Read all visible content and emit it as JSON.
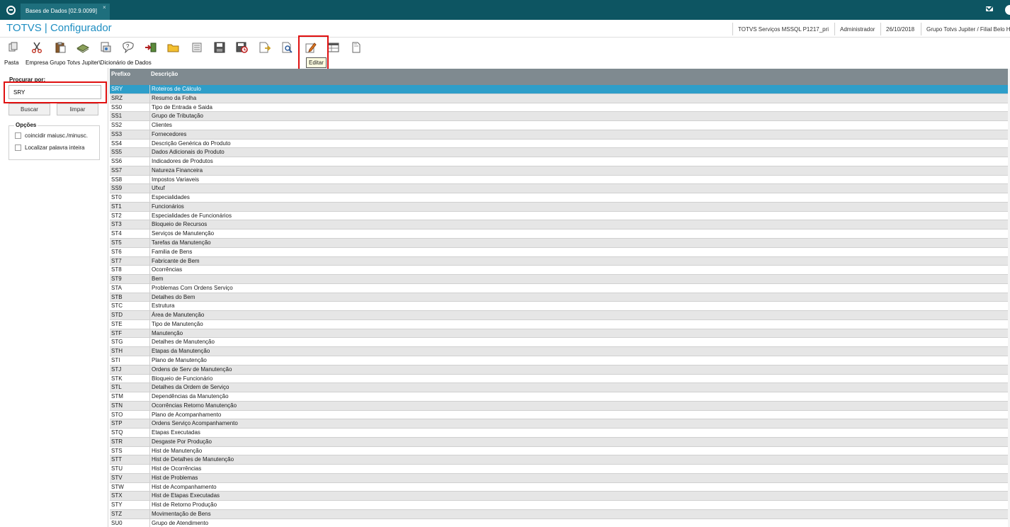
{
  "window": {
    "tab_label": "Bases de Dados [02.9.0099]",
    "tab_close": "×"
  },
  "header": {
    "app_title": "TOTVS | Configurador",
    "service": "TOTVS Serviços MSSQL P1217_pri",
    "user": "Administrador",
    "date": "26/10/2018",
    "company": "Grupo Totvs Jupiter / Filial Belo H"
  },
  "toolbar": {
    "tooltip": "Editar"
  },
  "breadcrumb": {
    "root": "Pasta",
    "path": "Empresa Grupo Totvs Jupiter\\Dicionário de Dados"
  },
  "search": {
    "label": "Procurar por:",
    "value": "SRY",
    "search_button": "Buscar",
    "clear_button": "limpar"
  },
  "options": {
    "title": "Opções",
    "items": [
      {
        "label": "coincidir maiusc./minusc.",
        "checked": false
      },
      {
        "label": "Localizar palavra inteira",
        "checked": false
      }
    ]
  },
  "grid": {
    "columns": [
      "Prefixo",
      "Descrição"
    ],
    "selected_row": 0,
    "rows": [
      [
        "SRY",
        "Roteiros de Cálculo"
      ],
      [
        "SRZ",
        "Resumo da Folha"
      ],
      [
        "SS0",
        "Tipo de Entrada e Saida"
      ],
      [
        "SS1",
        "Grupo de Tributação"
      ],
      [
        "SS2",
        "Clientes"
      ],
      [
        "SS3",
        "Fornecedores"
      ],
      [
        "SS4",
        "Descrição Genérica do Produto"
      ],
      [
        "SS5",
        "Dados Adicionais do Produto"
      ],
      [
        "SS6",
        "Indicadores de Produtos"
      ],
      [
        "SS7",
        "Natureza Financeira"
      ],
      [
        "SS8",
        "Impostos Variaveis"
      ],
      [
        "SS9",
        "Ufxuf"
      ],
      [
        "ST0",
        "Especialidades"
      ],
      [
        "ST1",
        "Funcionários"
      ],
      [
        "ST2",
        "Especialidades de Funcionários"
      ],
      [
        "ST3",
        "Bloqueio de Recursos"
      ],
      [
        "ST4",
        "Serviços de Manutenção"
      ],
      [
        "ST5",
        "Tarefas da Manutenção"
      ],
      [
        "ST6",
        "Familia de Bens"
      ],
      [
        "ST7",
        "Fabricante de Bem"
      ],
      [
        "ST8",
        "Ocorrências"
      ],
      [
        "ST9",
        "Bem"
      ],
      [
        "STA",
        "Problemas Com Ordens Serviço"
      ],
      [
        "STB",
        "Detalhes do Bem"
      ],
      [
        "STC",
        "Estrutura"
      ],
      [
        "STD",
        "Área de Manutenção"
      ],
      [
        "STE",
        "Tipo de Manutenção"
      ],
      [
        "STF",
        "Manutenção"
      ],
      [
        "STG",
        "Detalhes de Manutenção"
      ],
      [
        "STH",
        "Etapas da Manutenção"
      ],
      [
        "STI",
        "Plano de Manutenção"
      ],
      [
        "STJ",
        "Ordens de Serv de Manutenção"
      ],
      [
        "STK",
        "Bloqueio de Funcionário"
      ],
      [
        "STL",
        "Detalhes da Ordem de Serviço"
      ],
      [
        "STM",
        "Dependências da Manutenção"
      ],
      [
        "STN",
        "Ocorrências Retorno Manutenção"
      ],
      [
        "STO",
        "Plano de Acompanhamento"
      ],
      [
        "STP",
        "Ordens Serviço Acompanhamento"
      ],
      [
        "STQ",
        "Etapas Executadas"
      ],
      [
        "STR",
        "Desgaste Por Produção"
      ],
      [
        "STS",
        "Hist de Manutenção"
      ],
      [
        "STT",
        "Hist de Detalhes de Manutenção"
      ],
      [
        "STU",
        "Hist de Ocorrências"
      ],
      [
        "STV",
        "Hist de Problemas"
      ],
      [
        "STW",
        "Hist de Acompanhamento"
      ],
      [
        "STX",
        "Hist de Etapas Executadas"
      ],
      [
        "STY",
        "Hist de Retorno Produção"
      ],
      [
        "STZ",
        "Movimentação de Bens"
      ],
      [
        "SU0",
        "Grupo de Atendimento"
      ]
    ]
  }
}
